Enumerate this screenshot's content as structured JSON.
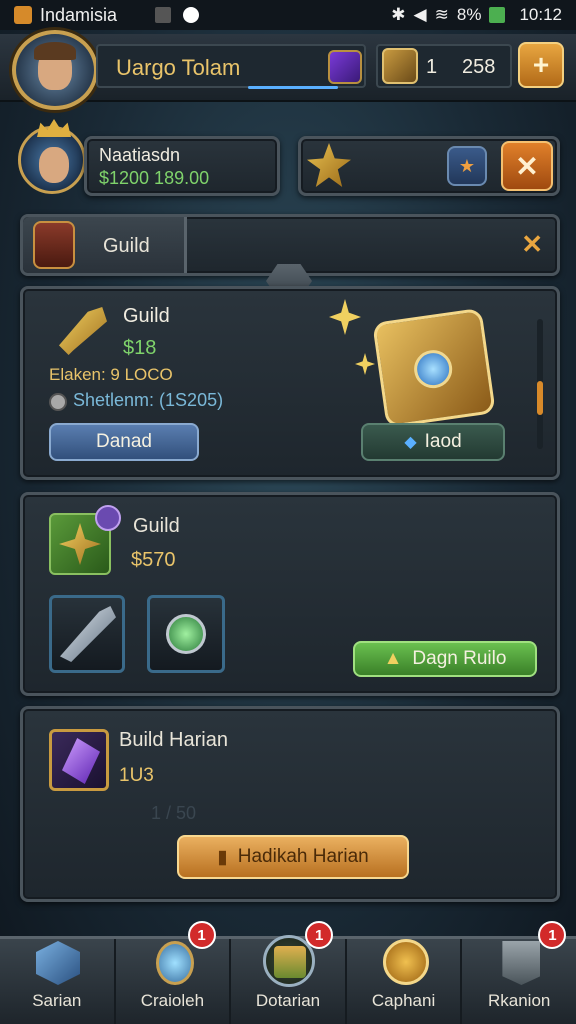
{
  "status_bar": {
    "app_name": "Indamisia",
    "battery": "8%",
    "time": "10:12"
  },
  "header": {
    "player_name": "Uargo Tolam",
    "currency_count": "1",
    "currency_value": "258",
    "add_label": "+"
  },
  "profile": {
    "name": "Naatiasdn",
    "gold": "$1200 189.00"
  },
  "guild_tab": {
    "label": "Guild",
    "close_label": "✕"
  },
  "guild_card": {
    "title": "Guild",
    "amount": "$18",
    "line1": "Elaken: 9 LOCO",
    "line2": "Shetlenm: (1S205)",
    "left_button": "Danad",
    "right_button": "Iaod"
  },
  "guild_reward": {
    "title": "Guild",
    "amount": "$570",
    "action_button": "Dagn Ruilo"
  },
  "daily": {
    "title": "Build Harian",
    "amount": "1U3",
    "progress_text": "1 / 50",
    "action_button": "Hadikah Harian"
  },
  "bottom_nav": [
    {
      "label": "Sarian",
      "badge": ""
    },
    {
      "label": "Craioleh",
      "badge": "1"
    },
    {
      "label": "Dotarian",
      "badge": "1"
    },
    {
      "label": "Caphani",
      "badge": ""
    },
    {
      "label": "Rkanion",
      "badge": "1"
    }
  ],
  "colors": {
    "gold": "#e9c46a",
    "green_button": "#4fa83a",
    "blue_button": "#3e5f8c",
    "orange_button": "#c9822e",
    "badge_red": "#d22a2a"
  }
}
